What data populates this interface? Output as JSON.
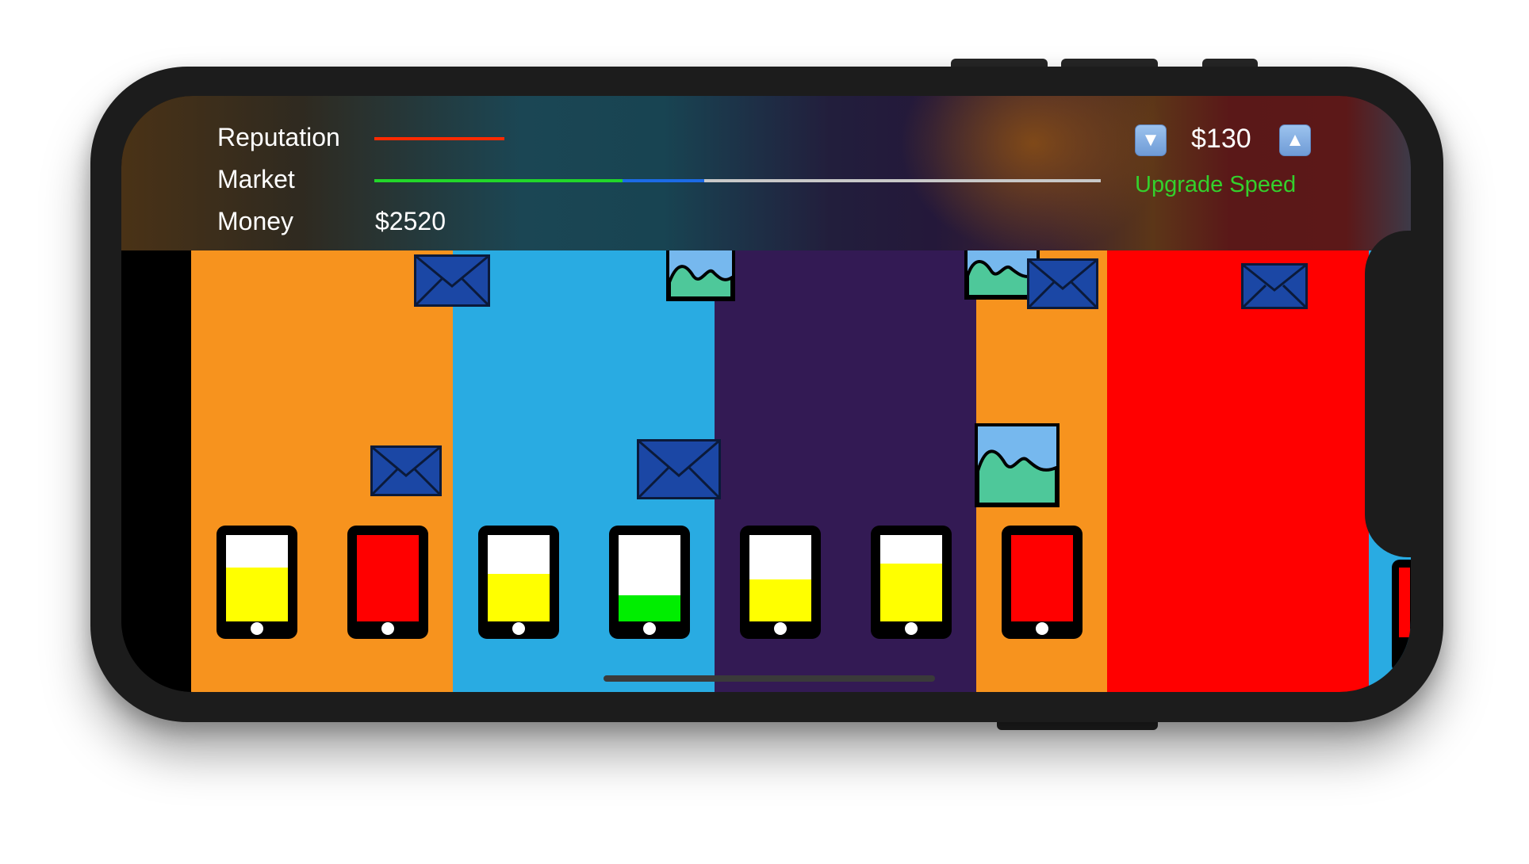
{
  "hud": {
    "reputation_label": "Reputation",
    "market_label": "Market",
    "money_label": "Money",
    "money_value": "$2520",
    "price_value": "$130",
    "upgrade_label": "Upgrade Speed",
    "decrease_icon": "triangle-down-icon",
    "increase_icon": "triangle-up-icon"
  },
  "meters": {
    "reputation_fraction": 0.18,
    "market_green_fraction": 0.34,
    "market_blue_fraction": 0.11
  },
  "colors": {
    "reputation_bar": "#ff2a00",
    "market_green": "#22d62a",
    "market_blue": "#1c6be6",
    "market_track": "#c8c8c8",
    "upgrade_text": "#34d02c",
    "lane_orange": "#f7931e",
    "lane_blue": "#29abe2",
    "lane_purple": "#331a54",
    "lane_red": "#ff0000"
  },
  "lanes": [
    "orange",
    "blue",
    "purple",
    "orange",
    "red"
  ],
  "phones": [
    {
      "lane_color": "orange",
      "fill_color": "#ffff00",
      "fill_level": 0.62
    },
    {
      "lane_color": "orange",
      "fill_color": "#ff0000",
      "fill_level": 1.0
    },
    {
      "lane_color": "blue",
      "fill_color": "#ffff00",
      "fill_level": 0.55
    },
    {
      "lane_color": "blue",
      "fill_color": "#00ee00",
      "fill_level": 0.3
    },
    {
      "lane_color": "purple",
      "fill_color": "#ffff00",
      "fill_level": 0.49
    },
    {
      "lane_color": "purple",
      "fill_color": "#ffff00",
      "fill_level": 0.67
    },
    {
      "lane_color": "orange",
      "fill_color": "#ff0000",
      "fill_level": 1.0
    }
  ],
  "falling_items": [
    {
      "type": "envelope-icon"
    },
    {
      "type": "envelope-icon"
    },
    {
      "type": "picture-icon"
    },
    {
      "type": "envelope-icon"
    },
    {
      "type": "picture-icon"
    },
    {
      "type": "envelope-icon"
    },
    {
      "type": "picture-icon"
    },
    {
      "type": "envelope-icon"
    }
  ]
}
